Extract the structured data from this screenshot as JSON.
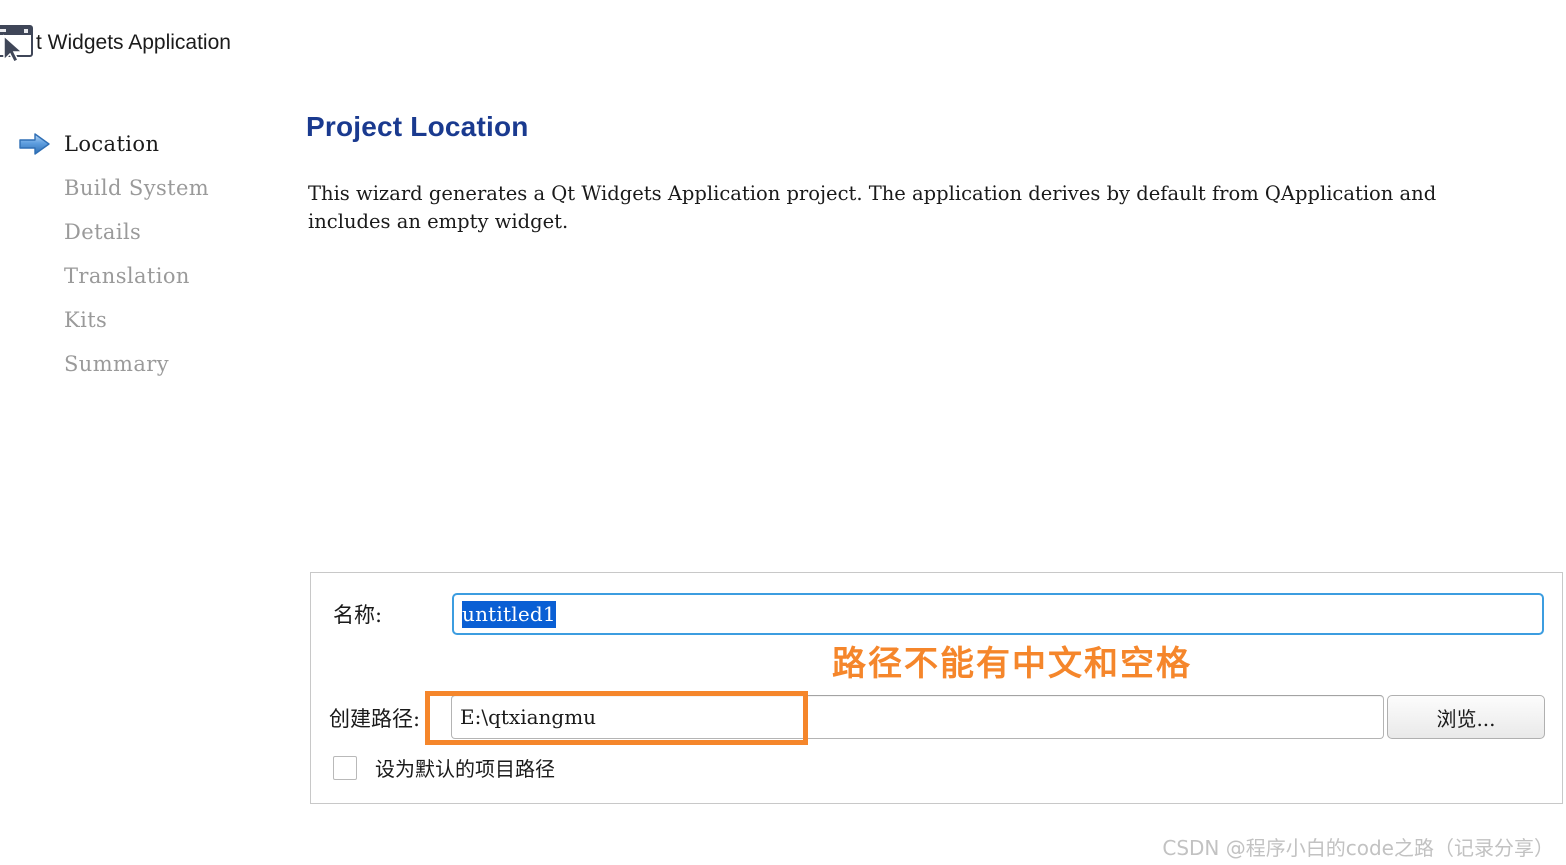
{
  "window": {
    "title": "t Widgets Application",
    "icon": "window-cursor-icon"
  },
  "sidebar": {
    "items": [
      {
        "label": "Location",
        "state": "current"
      },
      {
        "label": "Build System",
        "state": "upcoming"
      },
      {
        "label": "Details",
        "state": "upcoming"
      },
      {
        "label": "Translation",
        "state": "upcoming"
      },
      {
        "label": "Kits",
        "state": "upcoming"
      },
      {
        "label": "Summary",
        "state": "upcoming"
      }
    ],
    "current_marker_icon": "blue-right-arrow-icon"
  },
  "main": {
    "title": "Project Location",
    "description": "This wizard generates a Qt Widgets Application project. The application derives by default from QApplication and includes an empty widget."
  },
  "form": {
    "name_label": "名称:",
    "name_value": "untitled1",
    "name_selected": true,
    "path_label": "创建路径:",
    "path_value": "E:\\qtxiangmu",
    "browse_label": "浏览...",
    "checkbox_label": "设为默认的项目路径",
    "checkbox_checked": false
  },
  "annotations": {
    "note_text": "路径不能有中文和空格",
    "note_color": "#f5862b",
    "highlight_color": "#f5862b",
    "highlight_target": "创建路径 input"
  },
  "watermark": {
    "text": "CSDN @程序小白的code之路（记录分享）"
  },
  "colors": {
    "title_blue": "#1a3a8f",
    "focus_blue": "#3c9de0",
    "selection_blue": "#0a5fd4",
    "accent_orange": "#f5862b",
    "panel_border": "#c8c8c8",
    "dim_text": "#9a9a9a",
    "background": "#ffffff"
  }
}
